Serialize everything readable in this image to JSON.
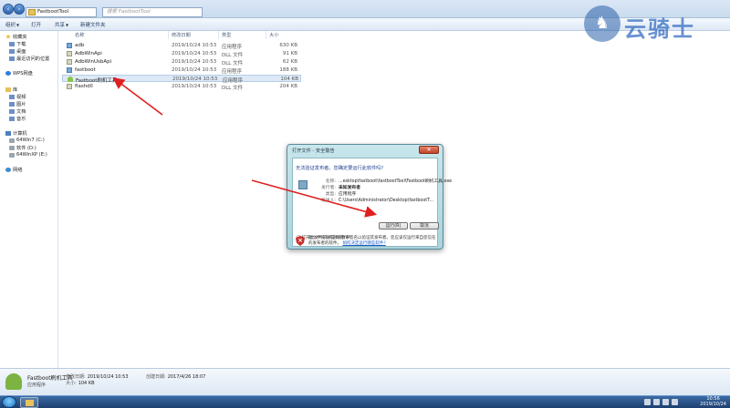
{
  "address": {
    "path": "FastbootTool",
    "search_placeholder": "搜索 FastbootTool"
  },
  "toolbar": {
    "organize": "组织",
    "open": "打开",
    "share": "共享",
    "new_folder": "新建文件夹"
  },
  "nav": {
    "favorites": "收藏夹",
    "downloads": "下载",
    "desktop": "桌面",
    "recent": "最近访问的位置",
    "wps": "WPS网盘",
    "libraries": "库",
    "videos": "视频",
    "pictures": "图片",
    "documents": "文档",
    "music": "音乐",
    "computer": "计算机",
    "drive_c": "64Win7 (C:)",
    "drive_d": "软件 (D:)",
    "drive_e": "64WinXP (E:)",
    "network": "网络"
  },
  "columns": {
    "name": "名称",
    "date": "修改日期",
    "type": "类型",
    "size": "大小"
  },
  "files": [
    {
      "name": "adb",
      "date": "2019/10/24 10:53",
      "type": "应用程序",
      "size": "630 KB",
      "icon": "exe"
    },
    {
      "name": "AdbWinApi",
      "date": "2019/10/24 10:53",
      "type": "DLL 文件",
      "size": "91 KB",
      "icon": "dll"
    },
    {
      "name": "AdbWinUsbApi",
      "date": "2019/10/24 10:53",
      "type": "DLL 文件",
      "size": "62 KB",
      "icon": "dll"
    },
    {
      "name": "fastboot",
      "date": "2019/10/24 10:53",
      "type": "应用程序",
      "size": "188 KB",
      "icon": "exe"
    },
    {
      "name": "Fastboot刷机工具",
      "date": "2019/10/24 10:53",
      "type": "应用程序",
      "size": "104 KB",
      "icon": "android"
    },
    {
      "name": "flashdll",
      "date": "2019/10/24 10:53",
      "type": "DLL 文件",
      "size": "204 KB",
      "icon": "dll"
    }
  ],
  "dialog": {
    "title": "打开文件 - 安全警告",
    "close": "✕",
    "question": "无法验证发布者。您确定要运行此软件吗?",
    "name_label": "名称:",
    "name_value": "...esktop\\fastboot\\fastbootTool\\Fastboot刷机工具.exe",
    "publisher_label": "发行者:",
    "publisher_value": "未知发布者",
    "type_label": "类型:",
    "type_value": "应用程序",
    "from_label": "发送人:",
    "from_value": "C:\\Users\\Administrator\\Desktop\\fastbootT...",
    "run": "运行(R)",
    "cancel": "取消",
    "always_ask": "打开此文件前总是询问(W)",
    "warning": "此文件没有有效的数字签名以验证其发布者。您应该仅运行来自您信任的发布者的软件。",
    "warning_link": "如何决定运行哪些软件?"
  },
  "details": {
    "name": "Fastboot刷机工具",
    "modified_label": "修改日期:",
    "modified_value": "2019/10/24 10:53",
    "created_label": "创建日期:",
    "created_value": "2017/4/26 18:07",
    "type_value": "应用程序",
    "size_label": "大小:",
    "size_value": "104 KB"
  },
  "taskbar": {
    "time": "10:56",
    "date": "2019/10/24"
  },
  "watermark": {
    "text": "云骑士"
  }
}
